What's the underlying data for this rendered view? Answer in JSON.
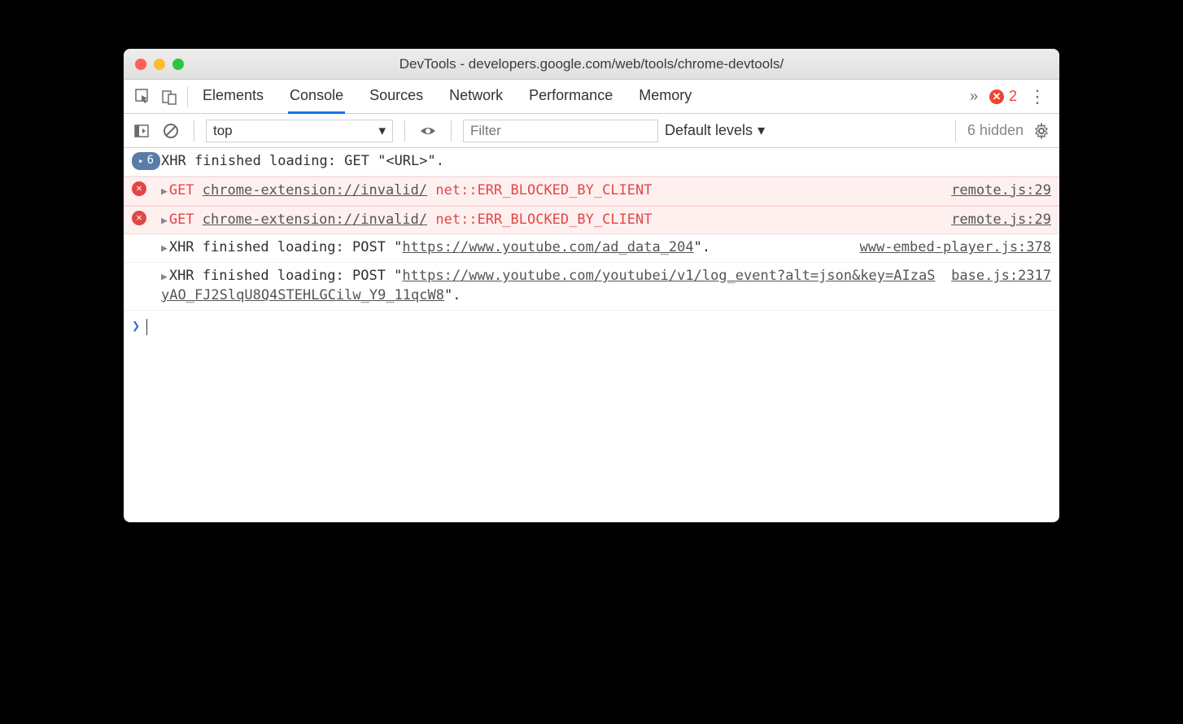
{
  "window": {
    "title": "DevTools - developers.google.com/web/tools/chrome-devtools/"
  },
  "tabs": {
    "items": [
      "Elements",
      "Console",
      "Sources",
      "Network",
      "Performance",
      "Memory"
    ],
    "active": "Console",
    "error_count": "2"
  },
  "toolbar": {
    "context": "top",
    "filter_placeholder": "Filter",
    "levels_label": "Default levels",
    "hidden_label": "6 hidden"
  },
  "messages": [
    {
      "type": "group",
      "count": "6",
      "text": "XHR finished loading: GET \"<URL>\"."
    },
    {
      "type": "error",
      "method": "GET",
      "url": "chrome-extension://invalid/",
      "err": "net::ERR_BLOCKED_BY_CLIENT",
      "source": "remote.js:29"
    },
    {
      "type": "error",
      "method": "GET",
      "url": "chrome-extension://invalid/",
      "err": "net::ERR_BLOCKED_BY_CLIENT",
      "source": "remote.js:29"
    },
    {
      "type": "log",
      "prefix": "XHR finished loading: POST \"",
      "url": "https://www.youtube.com/ad_data_204",
      "suffix": "\".",
      "source": "www-embed-player.js:378"
    },
    {
      "type": "log",
      "prefix": "XHR finished loading: POST \"",
      "url": "https://www.youtube.com/youtubei/v1/log_event?alt=json&key=AIzaSyAO_FJ2SlqU8Q4STEHLGCilw_Y9_11qcW8",
      "suffix": "\".",
      "source": "base.js:2317"
    }
  ]
}
